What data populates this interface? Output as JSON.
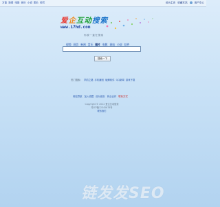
{
  "top_nav": {
    "items": [
      "万能",
      "新闻",
      "电影",
      "音乐",
      "小说",
      "图片",
      "软件"
    ]
  },
  "top_right": {
    "set_home": "设为主页",
    "favorite": "收藏本站",
    "user": "用户中心"
  },
  "logo": {
    "main_parts": [
      "爱",
      "企",
      "互",
      "动",
      "搜",
      "索"
    ],
    "domain": "www.i7hd.com",
    "slogan": "你我一直在搜索"
  },
  "search": {
    "tabs": [
      "视频",
      "网页",
      "新闻",
      "音乐",
      "图片",
      "电影",
      "网站",
      "小说",
      "软件"
    ],
    "active_tab_index": 4,
    "input_value": "",
    "button_label": "搜索一下"
  },
  "hot": {
    "label": "热门搜索：",
    "links": [
      "学前之路",
      "手机赚钱",
      "破解软件",
      "QQ新闻",
      "游戏下载"
    ]
  },
  "links": {
    "items": [
      "网站导航",
      "加入收藏",
      "设为首页",
      "商业合作"
    ],
    "highlight": "联系方式"
  },
  "footer": {
    "copyright": "Copyright © 2012 爱企互动搜索",
    "icp": "粤ICP备12345678号",
    "contact": "联系我们"
  },
  "watermark": "链发发SEO",
  "colors": {
    "link": "#2d5bb0",
    "accent_red": "#cc2b2b",
    "bg_top": "#dcecfa",
    "bg_bottom": "#b2d3f0"
  }
}
